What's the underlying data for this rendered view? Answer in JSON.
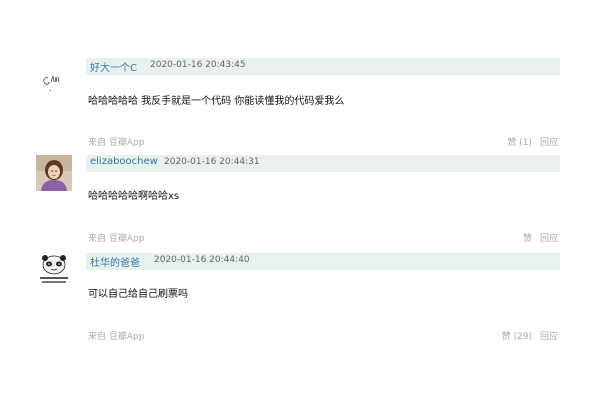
{
  "comments": [
    {
      "username": "好大一个C",
      "timestamp": "2020-01-16 20:43:45",
      "content": "哈哈哈哈哈 我反手就是一个代码 你能读懂我的代码爱我么",
      "source_prefix": "来自",
      "source_app": "豆瓣App",
      "like_label": "赞 (1)",
      "reply_label": "回应",
      "avatar_icon": "handwritten-signature-avatar"
    },
    {
      "username": "elizaboochew",
      "timestamp": "2020-01-16 20:44:31",
      "content": "哈哈哈哈哈啊哈哈xs",
      "source_prefix": "来自",
      "source_app": "豆瓣App",
      "like_label": "赞",
      "reply_label": "回应",
      "avatar_icon": "portrait-photo-avatar"
    },
    {
      "username": "杜华的爸爸",
      "timestamp": "2020-01-16 20:44:40",
      "content": "可以自己给自己刷票吗",
      "source_prefix": "来自",
      "source_app": "豆瓣App",
      "like_label": "赞 (29)",
      "reply_label": "回应",
      "avatar_icon": "panda-meme-avatar"
    }
  ],
  "colors": {
    "header_bg": "#e7f2ec",
    "username": "#3377aa",
    "muted": "#aaaaaa"
  }
}
